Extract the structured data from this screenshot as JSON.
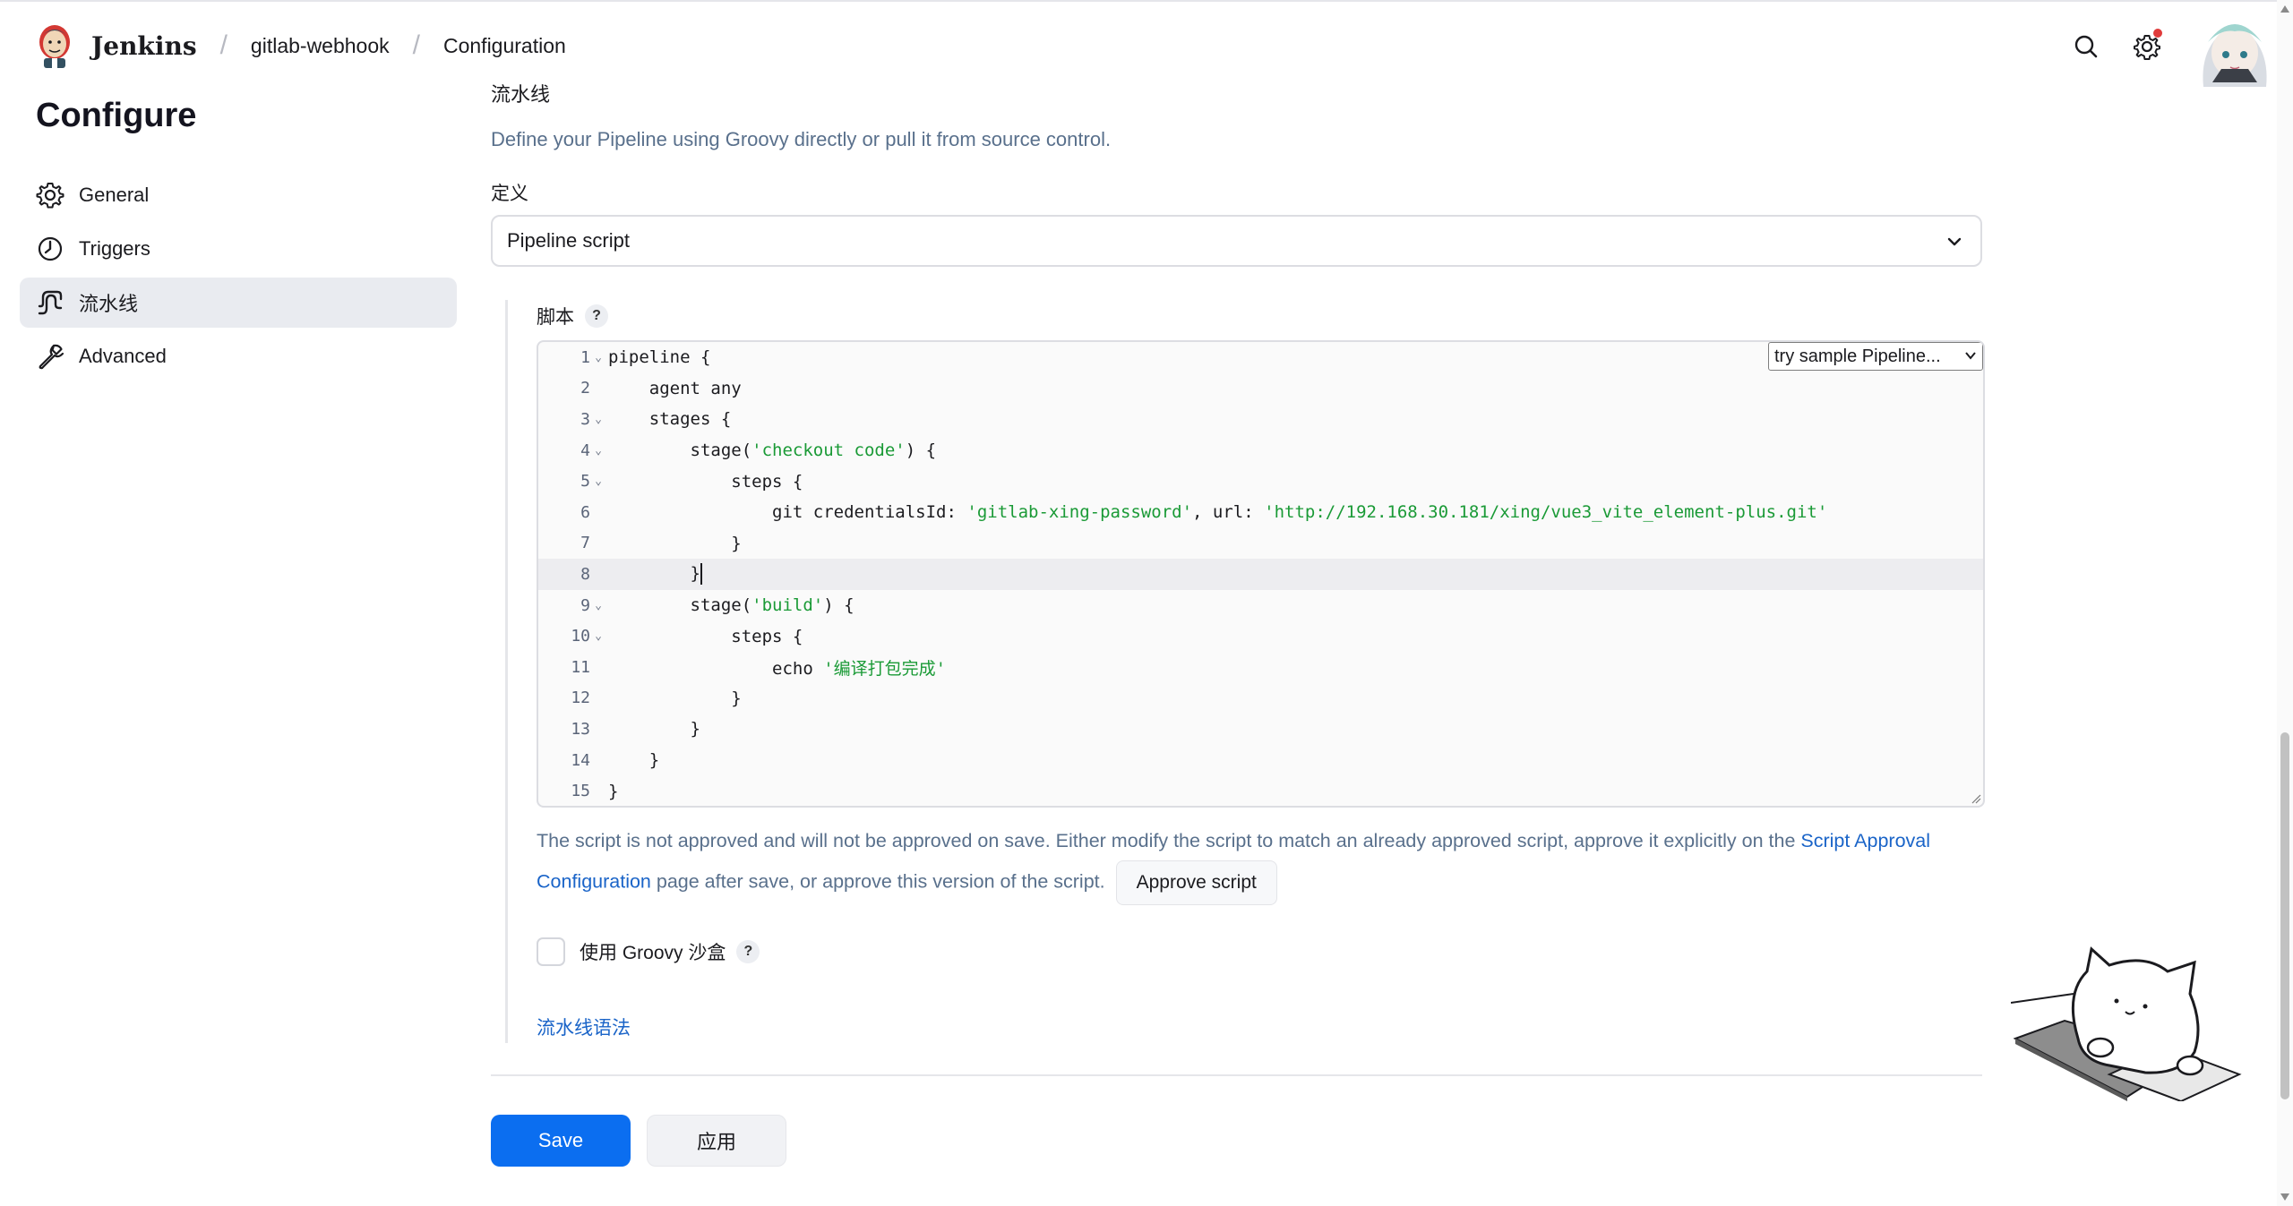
{
  "header": {
    "brand": "Jenkins",
    "breadcrumbs": [
      "gitlab-webhook",
      "Configuration"
    ]
  },
  "sidebar": {
    "title": "Configure",
    "items": [
      {
        "label": "General",
        "icon": "gear-icon"
      },
      {
        "label": "Triggers",
        "icon": "clock-icon"
      },
      {
        "label": "流水线",
        "icon": "pipeline-icon",
        "active": true
      },
      {
        "label": "Advanced",
        "icon": "wrench-icon"
      }
    ]
  },
  "pipeline": {
    "section_title": "流水线",
    "description": "Define your Pipeline using Groovy directly or pull it from source control.",
    "definition_label": "定义",
    "definition_value": "Pipeline script",
    "script_label": "脚本",
    "help_glyph": "?",
    "sample_select": "try sample Pipeline...",
    "code_lines": [
      {
        "n": "1",
        "fold": true,
        "text": "pipeline {"
      },
      {
        "n": "2",
        "fold": false,
        "text": "    agent any"
      },
      {
        "n": "3",
        "fold": true,
        "text": "    stages {"
      },
      {
        "n": "4",
        "fold": true,
        "pre": "        stage(",
        "str": "'checkout code'",
        "post": ") {"
      },
      {
        "n": "5",
        "fold": true,
        "text": "            steps {"
      },
      {
        "n": "6",
        "fold": false,
        "pre": "                git credentialsId: ",
        "str": "'gitlab-xing-password'",
        "mid": ", url: ",
        "str2": "'http://192.168.30.181/xing/vue3_vite_element-plus.git'"
      },
      {
        "n": "7",
        "fold": false,
        "text": "            }"
      },
      {
        "n": "8",
        "fold": false,
        "text": "        }",
        "active": true
      },
      {
        "n": "9",
        "fold": true,
        "pre": "        stage(",
        "str": "'build'",
        "post": ") {"
      },
      {
        "n": "10",
        "fold": true,
        "text": "            steps {"
      },
      {
        "n": "11",
        "fold": false,
        "pre": "                echo ",
        "str": "'编译打包完成'"
      },
      {
        "n": "12",
        "fold": false,
        "text": "            }"
      },
      {
        "n": "13",
        "fold": false,
        "text": "        }"
      },
      {
        "n": "14",
        "fold": false,
        "text": "    }"
      },
      {
        "n": "15",
        "fold": false,
        "text": "}"
      }
    ],
    "warning_text_1": "The script is not approved and will not be approved on save. Either modify the script to match an already approved script, approve it explicitly on the",
    "warning_link": "Script Approval Configuration",
    "warning_text_2": "page after save, or approve this version of the script.",
    "approve_button": "Approve script",
    "sandbox_label": "使用 Groovy 沙盒",
    "sandbox_checked": false,
    "syntax_link": "流水线语法"
  },
  "actions": {
    "save": "Save",
    "apply": "应用"
  },
  "colors": {
    "primary": "#0b6ef0",
    "link": "#1a64c8",
    "string": "#1a9a36",
    "muted": "#59708c"
  }
}
